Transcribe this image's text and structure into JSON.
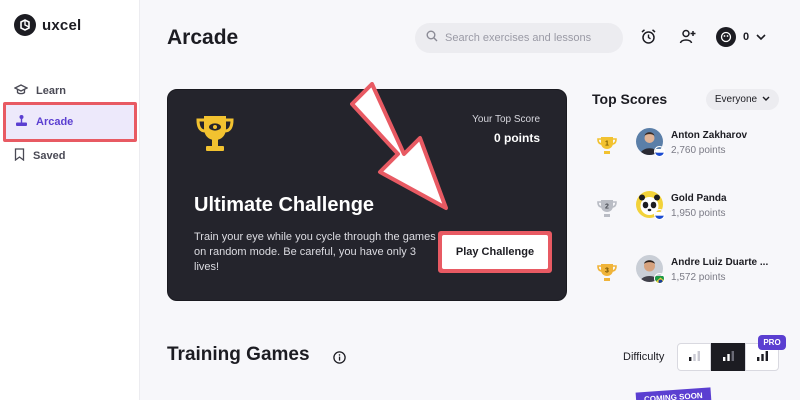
{
  "app": {
    "name": "uxcel"
  },
  "sidebar": {
    "items": [
      {
        "label": "Learn",
        "icon": "graduation-cap-icon"
      },
      {
        "label": "Arcade",
        "icon": "arcade-joystick-icon",
        "active": true
      },
      {
        "label": "Saved",
        "icon": "bookmark-icon"
      }
    ]
  },
  "header": {
    "title": "Arcade",
    "search_placeholder": "Search exercises and lessons",
    "coins": "0"
  },
  "challenge": {
    "top_score_label": "Your Top Score",
    "top_score_value": "0 points",
    "title": "Ultimate Challenge",
    "description": "Train your eye while you cycle through the games on random mode. Be careful, you have only 3 lives!",
    "button_label": "Play Challenge"
  },
  "top_scores": {
    "title": "Top Scores",
    "filter": "Everyone",
    "entries": [
      {
        "rank": "1",
        "name": "Anton Zakharov",
        "points": "2,760 points",
        "medal": "gold"
      },
      {
        "rank": "2",
        "name": "Gold Panda",
        "points": "1,950 points",
        "medal": "silver"
      },
      {
        "rank": "3",
        "name": "Andre Luiz Duarte ...",
        "points": "1,572 points",
        "medal": "bronze"
      }
    ]
  },
  "training": {
    "title": "Training Games",
    "difficulty_label": "Difficulty",
    "pro_badge": "PRO",
    "coming_soon": "COMING SOON"
  },
  "colors": {
    "accent": "#5b3fd1",
    "highlight": "#e85a63",
    "card": "#24242c",
    "gold": "#f2c230"
  }
}
